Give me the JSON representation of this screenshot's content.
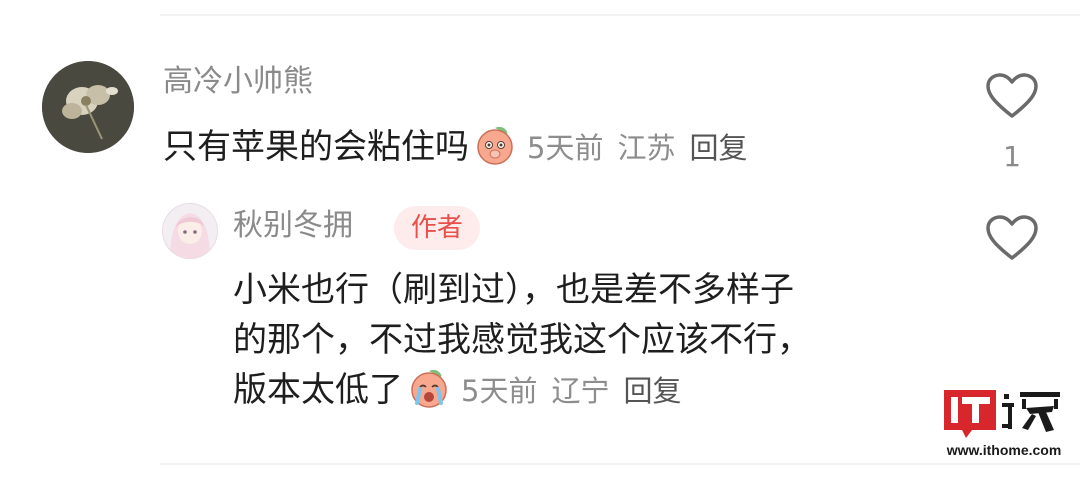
{
  "comment": {
    "username": "高冷小帅熊",
    "text": "只有苹果的会粘住吗",
    "emoji": "shy-peach-emoji",
    "time": "5天前",
    "location": "江苏",
    "reply_label": "回复",
    "like_count": "1"
  },
  "reply": {
    "username": "秋别冬拥",
    "badge": "作者",
    "lines": [
      "小米也行（刷到过），也是差不多样子",
      "的那个，不过我感觉我这个应该不行，",
      "版本太低了"
    ],
    "emoji": "crying-peach-emoji",
    "time": "5天前",
    "location": "辽宁",
    "reply_label": "回复"
  },
  "watermark": {
    "url": "www.ithome.com"
  },
  "colors": {
    "author_badge_bg": "#fdeceb",
    "author_badge_text": "#e8504a",
    "meta_text": "#8d8d8d"
  }
}
